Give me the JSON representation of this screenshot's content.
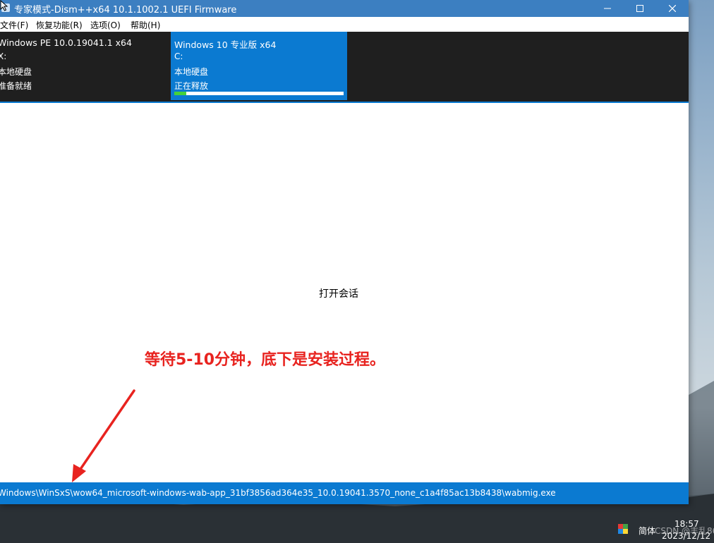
{
  "window": {
    "title": "专家模式-Dism++x64 10.1.1002.1 UEFI Firmware",
    "controls": {
      "minimize": "—",
      "maximize": "☐",
      "close": "✕"
    }
  },
  "menu": {
    "items": [
      {
        "label": "文件(F)"
      },
      {
        "label": "恢复功能(R)"
      },
      {
        "label": "选项(O)"
      },
      {
        "label": "帮助(H)"
      }
    ]
  },
  "sessions": [
    {
      "os": "Windows PE 10.0.19041.1 x64",
      "drive": "X:",
      "disk": "本地硬盘",
      "status": "准备就绪",
      "selected": false
    },
    {
      "os": "Windows 10 专业版 x64",
      "drive": "C:",
      "disk": "本地硬盘",
      "status": "正在释放",
      "selected": true,
      "progress": 0.07
    }
  ],
  "content": {
    "center_text": "打开会话"
  },
  "annotation": {
    "text": "等待5-10分钟，底下是安装过程。",
    "color": "#e8231f"
  },
  "status": {
    "path": "Windows\\WinSxS\\wow64_microsoft-windows-wab-app_31bf3856ad364e35_10.0.19041.3570_none_c1a4f85ac13b8438\\wabmig.exe"
  },
  "taskbar": {
    "ime": "简体",
    "watermark": "CSDN @丰乱86",
    "time": "18:57",
    "date": "2023/12/12"
  },
  "colors": {
    "titlebar": "#3c7fc1",
    "accent": "#0b7ad1",
    "session_bar": "#1f1f1f",
    "progress": "#45d13a"
  }
}
